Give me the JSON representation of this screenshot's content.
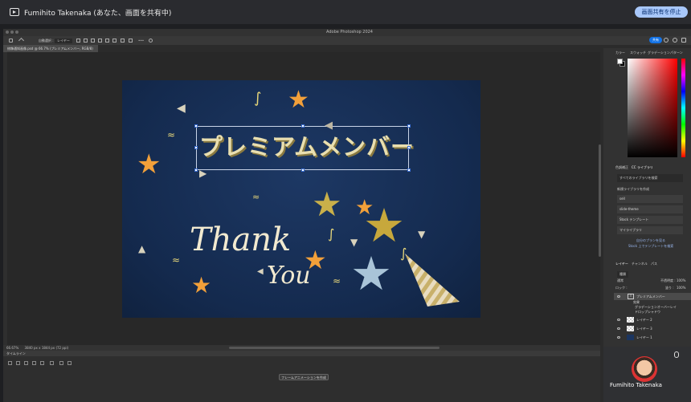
{
  "share": {
    "text": "Fumihito Takenaka (あなた、画面を共有中)",
    "stop_label": "画面共有を停止"
  },
  "app": {
    "title": "Adobe Photoshop 2024",
    "options": [
      "自動選択 :",
      "レイヤー"
    ],
    "share_label": "共有"
  },
  "document": {
    "tab_label": "修飾通知画像.psd @ 66.7% (プレミアムメンバー, RGB/8)",
    "zoom": "66.67%",
    "dimensions": "3840 px x 1844 px (72 ppi)"
  },
  "canvas": {
    "title": "プレミアムメンバー",
    "thank": "Thank",
    "you": "You"
  },
  "timeline": {
    "label": "タイムライン",
    "create_button": "フレームアニメーションを作成"
  },
  "panels": {
    "color_tabs": [
      "カラー",
      "スウォッチ",
      "グラデーション",
      "パターン"
    ],
    "lib_tabs": [
      "色調補正",
      "CC ライブラリ"
    ],
    "lib_search": "すべてのライブラリを検索",
    "new_library": "新規ライブラリを作成",
    "libraries": [
      "sell",
      "slide-theme",
      "Stock テンプレート",
      "マイライブラリ"
    ],
    "lib_links": [
      "自分のプランを見る",
      "Stock 上でテンプレートを検索"
    ],
    "layer_tabs": [
      "レイヤー",
      "チャンネル",
      "パス"
    ],
    "layer_kind": "種類",
    "blend_mode": "通常",
    "opacity_label": "不透明度 :",
    "opacity": "100%",
    "fill_label": "塗り :",
    "fill": "100%",
    "lock_label": "ロック :",
    "layers": [
      {
        "name": "プレミアムメンバー",
        "selected": true
      },
      {
        "name": "効果"
      },
      {
        "name": "グラデーションオーバーレイ"
      },
      {
        "name": "ドロップシャドウ"
      },
      {
        "name": "レイヤー 2"
      },
      {
        "name": "レイヤー 3"
      },
      {
        "name": "レイヤー 1"
      }
    ]
  },
  "video": {
    "name": "Fumihito Takenaka"
  },
  "colors": {
    "canvas_bg": "#142a4e",
    "title_gold": "#e9dfb0",
    "star_orange": "#f2a03a",
    "accent_blue": "#1473e6"
  }
}
